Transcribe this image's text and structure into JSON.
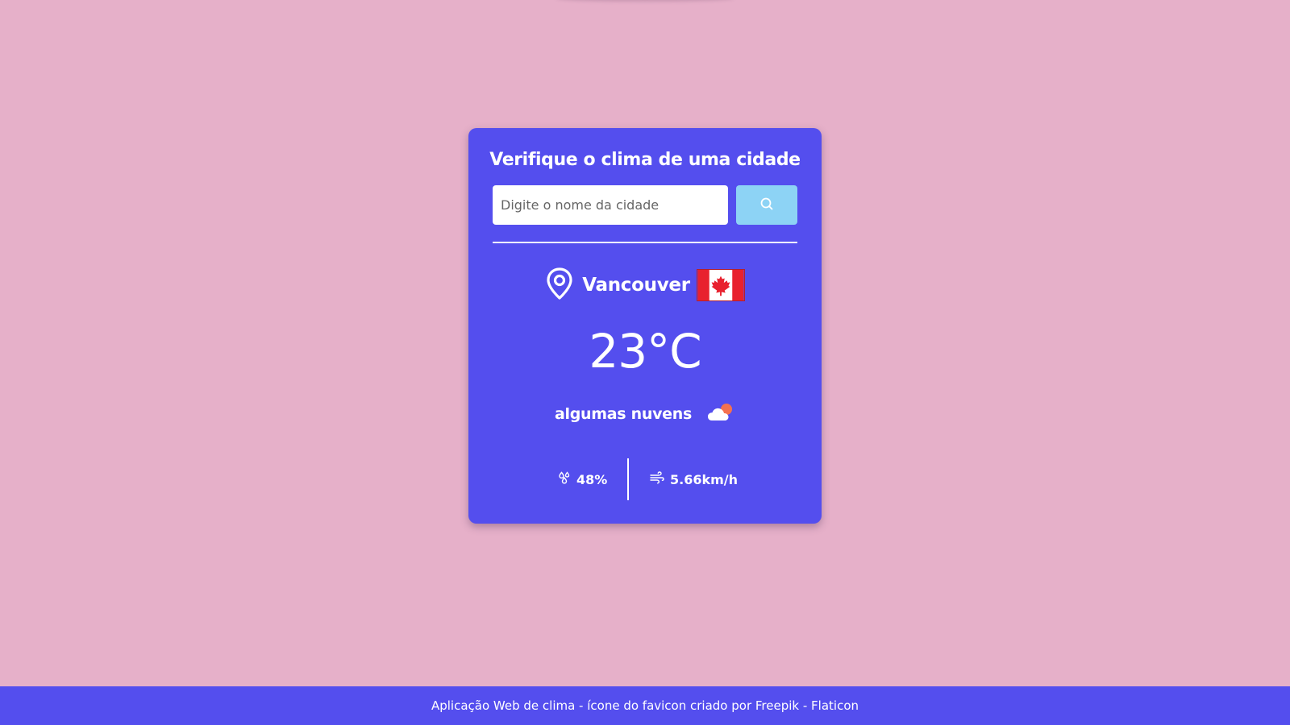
{
  "card": {
    "title": "Verifique o clima de uma cidade",
    "search": {
      "placeholder": "Digite o nome da cidade",
      "value": "",
      "button_icon": "search-icon"
    }
  },
  "weather": {
    "location_icon": "map-pin-icon",
    "city": "Vancouver",
    "country_flag": "canada-flag",
    "temperature": "23",
    "temperature_unit": "°C",
    "description": "algumas nuvens",
    "description_icon": "partly-cloudy-icon",
    "humidity_icon": "humidity-icon",
    "humidity": "48%",
    "wind_icon": "wind-icon",
    "wind": "5.66km/h"
  },
  "footer": {
    "text": "Aplicação Web de clima - ícone do favicon criado por Freepik - Flaticon"
  },
  "colors": {
    "background": "#e6b0c9",
    "card": "#544eee",
    "search_button": "#8dd3f5",
    "footer": "#544eee",
    "text": "#ffffff"
  }
}
